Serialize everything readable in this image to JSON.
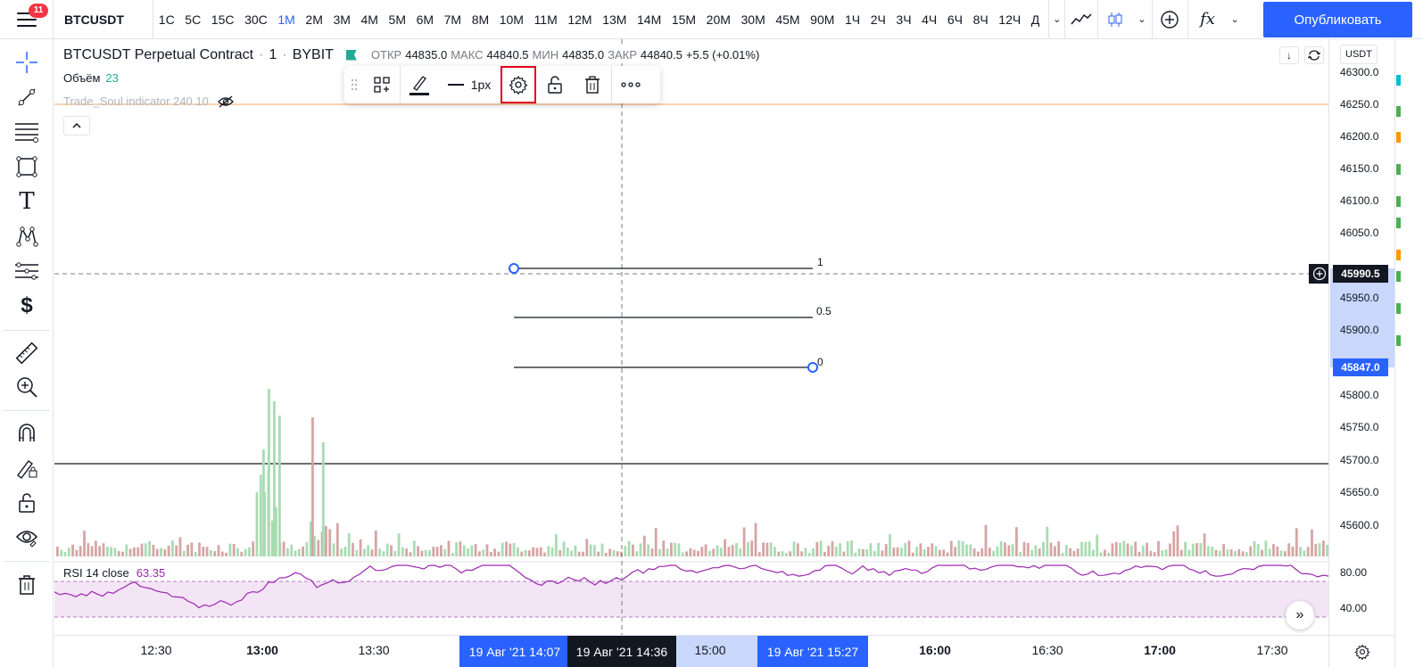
{
  "topbar": {
    "notification_count": "11",
    "symbol": "BTCUSDT",
    "intervals": [
      "1С",
      "5С",
      "15С",
      "30С",
      "1М",
      "2М",
      "3М",
      "4М",
      "5М",
      "6М",
      "7М",
      "8М",
      "10М",
      "11М",
      "12М",
      "13М",
      "14М",
      "15М",
      "20М",
      "30М",
      "45М",
      "90М",
      "1Ч",
      "2Ч",
      "3Ч",
      "4Ч",
      "6Ч",
      "8Ч",
      "12Ч",
      "Д"
    ],
    "active_interval": "1М",
    "publish_label": "Опубликовать",
    "fx_label": "fx"
  },
  "legend": {
    "title": "BTCUSDT Perpetual Contract",
    "separator": "·",
    "interval": "1",
    "exchange": "BYBIT",
    "open_label": "ОТКР",
    "open": "44835.0",
    "high_label": "МАКС",
    "high": "44840.5",
    "low_label": "МИН",
    "low": "44835.0",
    "close_label": "ЗАКР",
    "close": "44840.5",
    "change": "+5.5 (+0.01%)",
    "volume_label": "Объём",
    "volume": "23",
    "indicator": "Trade_Soul indicator 240 10"
  },
  "float_toolbar": {
    "width_label": "1px"
  },
  "fib": {
    "levels": [
      "1",
      "0.5",
      "0"
    ]
  },
  "rsi": {
    "label": "RSI 14 close",
    "value": "63.35",
    "ticks": [
      "80.00",
      "40.00"
    ]
  },
  "price_axis": {
    "currency": "USDT",
    "ticks": [
      "46300.0",
      "46250.0",
      "46200.0",
      "46150.0",
      "46100.0",
      "46050.0",
      "45950.0",
      "45900.0",
      "45800.0",
      "45750.0",
      "45700.0",
      "45650.0",
      "45600.0"
    ],
    "crosshair_price": "45990.5",
    "marker_price": "45847.0"
  },
  "time_axis": {
    "ticks": [
      "12:30",
      "13:00",
      "13:30",
      "15:00",
      "16:00",
      "16:30",
      "17:00",
      "17:30"
    ],
    "bold_ticks": [
      "13:00",
      "16:00",
      "17:00"
    ],
    "label_left": "19 Авг '21   14:07",
    "label_cross": "19 Авг '21   14:36",
    "label_right": "19 Авг '21   15:27"
  },
  "colors": {
    "accent": "#2962ff",
    "up": "#22ab94",
    "vol_up": "#a9dcb3",
    "vol_down": "#d6a5a5",
    "rsi": "#9c27b0",
    "rsi_band": "#f3e5f5",
    "highlight": "#e3001b"
  }
}
